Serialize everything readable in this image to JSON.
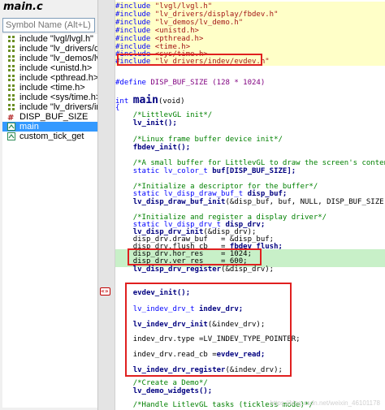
{
  "sidebar": {
    "file_title": "main.c",
    "search_placeholder": "Symbol Name (Alt+L)",
    "items": [
      {
        "label": "include \"lvgl/lvgl.h\"",
        "icon": "include-icon"
      },
      {
        "label": "include \"lv_drivers/dis",
        "icon": "include-icon"
      },
      {
        "label": "include \"lv_demos/lv_d",
        "icon": "include-icon"
      },
      {
        "label": "include <unistd.h>",
        "icon": "include-icon"
      },
      {
        "label": "include <pthread.h>",
        "icon": "include-icon"
      },
      {
        "label": "include <time.h>",
        "icon": "include-icon"
      },
      {
        "label": "include <sys/time.h>",
        "icon": "include-icon"
      },
      {
        "label": "include \"lv_drivers/ind",
        "icon": "include-icon"
      },
      {
        "label": "DISP_BUF_SIZE",
        "icon": "define-icon"
      },
      {
        "label": "main",
        "icon": "function-icon",
        "selected": true
      },
      {
        "label": "custom_tick_get",
        "icon": "function-icon"
      }
    ]
  },
  "gutter": {
    "marker_text": "«»"
  },
  "code": {
    "includes": [
      "\"lvgl/lvgl.h\"",
      "\"lv_drivers/display/fbdev.h\"",
      "\"lv_demos/lv_demo.h\"",
      "<unistd.h>",
      "<pthread.h>",
      "<time.h>",
      "<sys/time.h>",
      "\"lv_drivers/indev/evdev.h\""
    ],
    "include_kw": "#include",
    "define_kw": "#define",
    "define_name": "DISP_BUF_SIZE",
    "define_value": "(128 * 1024)",
    "main_ret": "int",
    "main_name": "main",
    "main_args": "(void)",
    "open_brace": "{",
    "cmt_littlevgl": "/*LittlevGL init*/",
    "lv_init": "lv_init();",
    "cmt_fbdev": "/*Linux frame buffer device init*/",
    "fbdev_init": "fbdev_init();",
    "cmt_buffer": "/*A small buffer for LittlevGL to draw the screen's content*/",
    "buf_static": "static lv_color_t",
    "buf_decl": "buf[DISP_BUF_SIZE];",
    "cmt_descriptor": "/*Initialize a descriptor for the buffer*/",
    "dispbuf_static": "static lv_disp_draw_buf_t",
    "dispbuf_decl": "disp_buf;",
    "dispbuf_init_fn": "lv_disp_draw_buf_init",
    "dispbuf_init_args": "(&disp_buf, buf, NULL, DISP_BUF_SIZE);",
    "cmt_register": "/*Initialize and register a display driver*/",
    "dispdrv_static": "static lv_disp_drv_t",
    "dispdrv_decl": "disp_drv;",
    "dispdrv_init_fn": "lv_disp_drv_init",
    "dispdrv_init_args": "(&disp_drv);",
    "draw_buf_line": "disp_drv.draw_buf   = &disp_buf;",
    "flush_cb_lhs": "disp_drv.flush_cb   = ",
    "flush_cb_rhs": "fbdev_flush;",
    "hor_res_line": "disp_drv.hor_res    = 1024;",
    "ver_res_line": "disp_drv.ver_res    = 600;",
    "register_fn": "lv_disp_drv_register",
    "register_args": "(&disp_drv);",
    "evdev_init": "evdev_init();",
    "indev_static": "lv_indev_drv_t",
    "indev_decl": "indev_drv;",
    "indev_init_fn": "lv_indev_drv_init",
    "indev_init_args": "(&indev_drv);",
    "indev_type_line": "indev_drv.type =LV_INDEV_TYPE_POINTER;",
    "read_cb_lhs": "indev_drv.read_cb =",
    "read_cb_rhs": "evdev_read;",
    "indev_register_fn": "lv_indev_drv_register",
    "indev_register_args": "(&indev_drv);",
    "cmt_demo": "/*Create a Demo*/",
    "demo_widgets": "lv_demo_widgets();",
    "cmt_tasks": "/*Handle LitlevGL tasks (tickless mode)*/"
  },
  "watermark": "https://blog.csdn.net/weixin_46101178"
}
